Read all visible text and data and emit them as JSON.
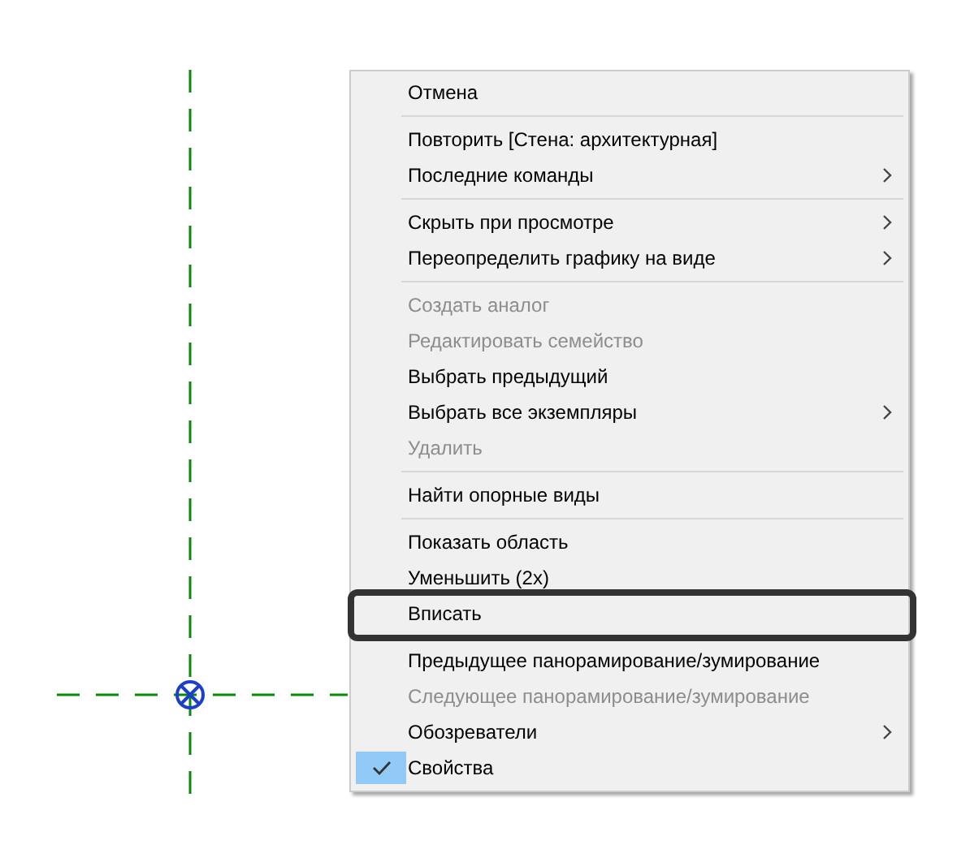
{
  "context_menu": {
    "items": [
      {
        "kind": "item",
        "label": "Отмена",
        "disabled": false,
        "submenu": false,
        "checked": false,
        "highlighted": false
      },
      {
        "kind": "separator"
      },
      {
        "kind": "item",
        "label": "Повторить [Стена: архитектурная]",
        "disabled": false,
        "submenu": false,
        "checked": false,
        "highlighted": false
      },
      {
        "kind": "item",
        "label": "Последние команды",
        "disabled": false,
        "submenu": true,
        "checked": false,
        "highlighted": false
      },
      {
        "kind": "separator"
      },
      {
        "kind": "item",
        "label": "Скрыть при просмотре",
        "disabled": false,
        "submenu": true,
        "checked": false,
        "highlighted": false
      },
      {
        "kind": "item",
        "label": "Переопределить графику на виде",
        "disabled": false,
        "submenu": true,
        "checked": false,
        "highlighted": false
      },
      {
        "kind": "separator"
      },
      {
        "kind": "item",
        "label": "Создать аналог",
        "disabled": true,
        "submenu": false,
        "checked": false,
        "highlighted": false
      },
      {
        "kind": "item",
        "label": "Редактировать семейство",
        "disabled": true,
        "submenu": false,
        "checked": false,
        "highlighted": false
      },
      {
        "kind": "item",
        "label": "Выбрать предыдущий",
        "disabled": false,
        "submenu": false,
        "checked": false,
        "highlighted": false
      },
      {
        "kind": "item",
        "label": "Выбрать все экземпляры",
        "disabled": false,
        "submenu": true,
        "checked": false,
        "highlighted": false
      },
      {
        "kind": "item",
        "label": "Удалить",
        "disabled": true,
        "submenu": false,
        "checked": false,
        "highlighted": false
      },
      {
        "kind": "separator"
      },
      {
        "kind": "item",
        "label": "Найти опорные виды",
        "disabled": false,
        "submenu": false,
        "checked": false,
        "highlighted": false
      },
      {
        "kind": "separator"
      },
      {
        "kind": "item",
        "label": "Показать область",
        "disabled": false,
        "submenu": false,
        "checked": false,
        "highlighted": false
      },
      {
        "kind": "item",
        "label": "Уменьшить (2x)",
        "disabled": false,
        "submenu": false,
        "checked": false,
        "highlighted": false
      },
      {
        "kind": "item",
        "label": "Вписать",
        "disabled": false,
        "submenu": false,
        "checked": false,
        "highlighted": true
      },
      {
        "kind": "separator"
      },
      {
        "kind": "item",
        "label": "Предыдущее панорамирование/зумирование",
        "disabled": false,
        "submenu": false,
        "checked": false,
        "highlighted": false
      },
      {
        "kind": "item",
        "label": "Следующее панорамирование/зумирование",
        "disabled": true,
        "submenu": false,
        "checked": false,
        "highlighted": false
      },
      {
        "kind": "item",
        "label": "Обозреватели",
        "disabled": false,
        "submenu": true,
        "checked": false,
        "highlighted": false
      },
      {
        "kind": "item",
        "label": "Свойства",
        "disabled": false,
        "submenu": false,
        "checked": true,
        "highlighted": false
      }
    ]
  }
}
